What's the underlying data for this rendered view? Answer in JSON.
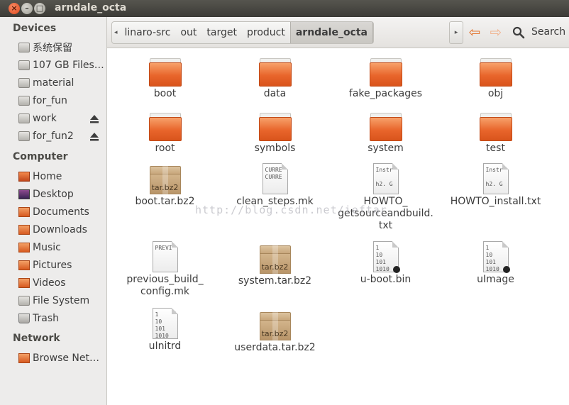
{
  "window": {
    "title": "arndale_octa"
  },
  "sidebar": {
    "devices_header": "Devices",
    "devices": [
      {
        "label": "系统保留",
        "icon": "drive-icon"
      },
      {
        "label": "107 GB Files…",
        "icon": "drive-icon"
      },
      {
        "label": "material",
        "icon": "drive-icon"
      },
      {
        "label": "for_fun",
        "icon": "drive-icon"
      },
      {
        "label": "work",
        "icon": "drive-icon"
      },
      {
        "label": "for_fun2",
        "icon": "drive-icon"
      }
    ],
    "computer_header": "Computer",
    "computer": [
      {
        "label": "Home",
        "icon": "home-icon"
      },
      {
        "label": "Desktop",
        "icon": "desktop-icon"
      },
      {
        "label": "Documents",
        "icon": "folder-icon"
      },
      {
        "label": "Downloads",
        "icon": "folder-icon"
      },
      {
        "label": "Music",
        "icon": "folder-icon"
      },
      {
        "label": "Pictures",
        "icon": "folder-icon"
      },
      {
        "label": "Videos",
        "icon": "folder-icon"
      },
      {
        "label": "File System",
        "icon": "drive-icon"
      },
      {
        "label": "Trash",
        "icon": "trash-icon"
      }
    ],
    "network_header": "Network",
    "network": [
      {
        "label": "Browse Net…",
        "icon": "network-icon"
      }
    ]
  },
  "toolbar": {
    "breadcrumbs": [
      "linaro-src",
      "out",
      "target",
      "product",
      "arndale_octa"
    ],
    "search_label": "Search"
  },
  "files": [
    {
      "name": "boot",
      "type": "folder"
    },
    {
      "name": "data",
      "type": "folder"
    },
    {
      "name": "fake_packages",
      "type": "folder"
    },
    {
      "name": "obj",
      "type": "folder"
    },
    {
      "name": "root",
      "type": "folder"
    },
    {
      "name": "symbols",
      "type": "folder"
    },
    {
      "name": "system",
      "type": "folder"
    },
    {
      "name": "test",
      "type": "folder"
    },
    {
      "name": "boot.tar.bz2",
      "type": "archive",
      "badge": "tar.bz2"
    },
    {
      "name": "clean_steps.mk",
      "type": "text",
      "preview": "CURRE\nCURRE"
    },
    {
      "name": "HOWTO_ getsourceandbuild. txt",
      "type": "text",
      "preview": "Instr\n\nh2. G"
    },
    {
      "name": "HOWTO_install.txt",
      "type": "text",
      "preview": "Instr\n\nh2. G"
    },
    {
      "name": "previous_build_ config.mk",
      "type": "text",
      "preview": "PREVI"
    },
    {
      "name": "system.tar.bz2",
      "type": "archive",
      "badge": "tar.bz2"
    },
    {
      "name": "u-boot.bin",
      "type": "binary",
      "preview": "1\n10\n101\n1010"
    },
    {
      "name": "uImage",
      "type": "binary",
      "preview": "1\n10\n101\n1010"
    },
    {
      "name": "uInitrd",
      "type": "binary",
      "preview": "1\n10\n101\n1010"
    },
    {
      "name": "userdata.tar.bz2",
      "type": "archive",
      "badge": "tar.bz2"
    }
  ],
  "watermark": "http://blog.csdn.net/ieftar"
}
